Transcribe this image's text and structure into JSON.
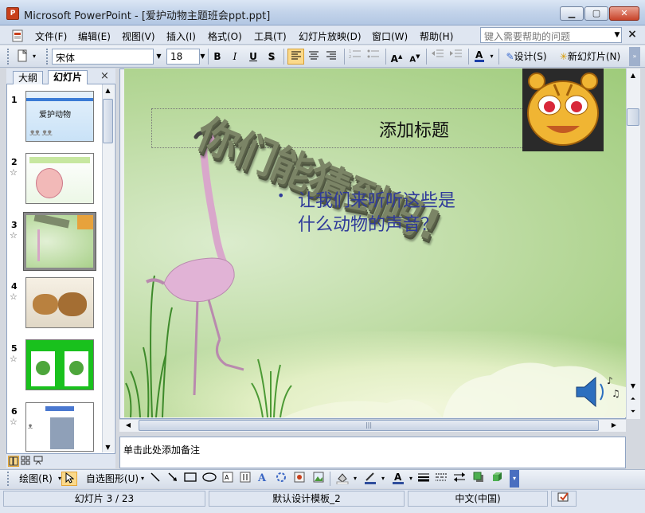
{
  "window": {
    "app_icon": "P",
    "title": "Microsoft PowerPoint - [爱护动物主题班会ppt.ppt]",
    "min_label": "▁",
    "max_label": "▢",
    "close_label": "✕"
  },
  "menu": {
    "items": [
      "文件(F)",
      "编辑(E)",
      "视图(V)",
      "插入(I)",
      "格式(O)",
      "工具(T)",
      "幻灯片放映(D)",
      "窗口(W)",
      "帮助(H)"
    ],
    "help_placeholder": "键入需要帮助的问题",
    "close_label": "×"
  },
  "toolbar": {
    "font_name": "宋体",
    "font_size": "18",
    "bold": "B",
    "italic": "I",
    "underline": "U",
    "shadow": "S",
    "design_label": "设计(S)",
    "new_slide_label": "新幻灯片(N)"
  },
  "pane": {
    "tab_outline": "大纲",
    "tab_slides": "幻灯片",
    "close_label": "×",
    "thumbnails": [
      {
        "number": "1",
        "caption": "爱护动物"
      },
      {
        "number": "2",
        "caption": ""
      },
      {
        "number": "3",
        "caption": ""
      },
      {
        "number": "4",
        "caption": ""
      },
      {
        "number": "5",
        "caption": ""
      },
      {
        "number": "6",
        "caption": ""
      }
    ]
  },
  "slide": {
    "wordart": "你们能猜到吗!",
    "title_placeholder": "添加标题",
    "bullet_line1": "让我们来听听这些是",
    "bullet_line2": "什么动物的声音？",
    "bullet_mark": "•"
  },
  "notes": {
    "placeholder": "单击此处添加备注"
  },
  "drawbar": {
    "draw_label": "绘图(R)",
    "autoshape_label": "自选图形(U)"
  },
  "status": {
    "slide_info": "幻灯片 3 / 23",
    "template": "默认设计模板_2",
    "language": "中文(中国)"
  },
  "colors": {
    "bullet_text": "#2f3a9a",
    "slide_green": "#b9d99d"
  }
}
